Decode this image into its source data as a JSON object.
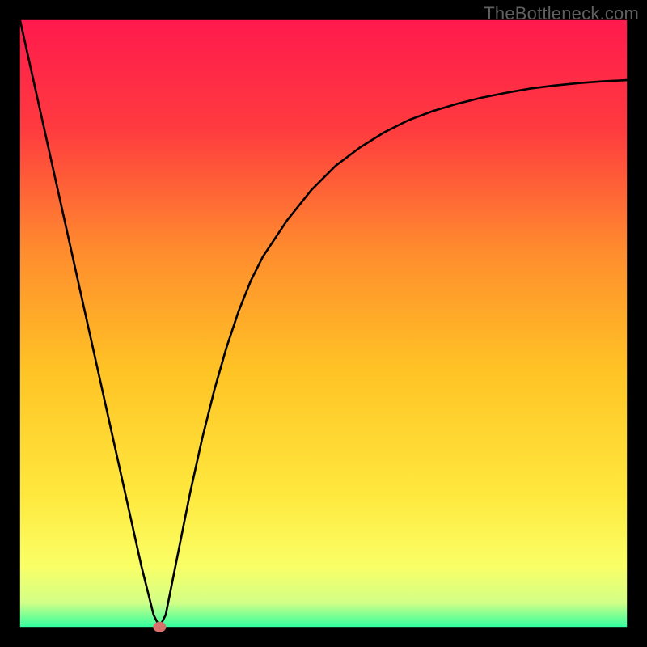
{
  "watermark": "TheBottleneck.com",
  "chart_data": {
    "type": "line",
    "title": "",
    "xlabel": "",
    "ylabel": "",
    "xlim": [
      0,
      100
    ],
    "ylim": [
      0,
      100
    ],
    "series": [
      {
        "name": "curve",
        "x": [
          0,
          2,
          4,
          6,
          8,
          10,
          12,
          14,
          16,
          18,
          20,
          22,
          23,
          24,
          26,
          28,
          30,
          32,
          34,
          36,
          38,
          40,
          44,
          48,
          52,
          56,
          60,
          64,
          68,
          72,
          76,
          80,
          84,
          88,
          92,
          96,
          100
        ],
        "values": [
          100,
          91,
          82,
          73,
          64,
          55,
          46,
          37,
          28,
          19,
          10,
          2,
          0,
          2,
          12,
          22,
          31,
          39,
          46,
          52,
          57,
          61,
          67,
          72,
          76,
          79,
          81.5,
          83.5,
          85,
          86.2,
          87.2,
          88,
          88.7,
          89.2,
          89.6,
          89.9,
          90.1
        ]
      }
    ],
    "marker": {
      "x": 23,
      "y": 0,
      "color": "#d8716b"
    },
    "frame_color": "#000000",
    "inner_margin_pct": 3.1,
    "background_gradient": [
      {
        "stop": 0.0,
        "color": "#ff1a4d"
      },
      {
        "stop": 0.18,
        "color": "#ff3b3f"
      },
      {
        "stop": 0.38,
        "color": "#ff8c2e"
      },
      {
        "stop": 0.58,
        "color": "#ffc425"
      },
      {
        "stop": 0.78,
        "color": "#ffe83d"
      },
      {
        "stop": 0.9,
        "color": "#faff66"
      },
      {
        "stop": 0.96,
        "color": "#d2ff87"
      },
      {
        "stop": 1.0,
        "color": "#31ff9e"
      }
    ]
  }
}
